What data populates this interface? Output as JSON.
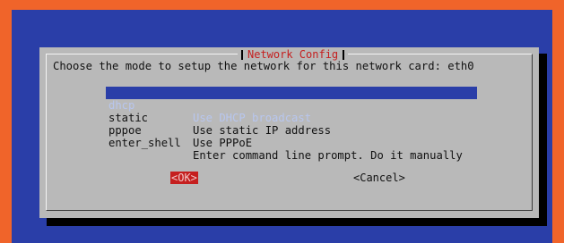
{
  "dialog": {
    "title": "Network Config",
    "prompt": "Choose the mode to setup the network for this network card: eth0"
  },
  "menu": {
    "items": [
      {
        "tag": "dhcp",
        "description": "Use DHCP broadcast",
        "selected": true
      },
      {
        "tag": "static",
        "description": "Use static IP address",
        "selected": false
      },
      {
        "tag": "pppoe",
        "description": "Use PPPoE",
        "selected": false
      },
      {
        "tag": "enter_shell",
        "description": "Enter command line prompt. Do it manually",
        "selected": false
      }
    ]
  },
  "buttons": {
    "ok_label": "<OK>",
    "cancel_label": "<Cancel>"
  },
  "colors": {
    "outer_border": "#f0642a",
    "screen_background": "#2a3ea8",
    "dialog_background": "#b9b9b9",
    "title_color": "#c51f1f",
    "selection_background": "#2a3ea8",
    "ok_button_background": "#c51f1f"
  }
}
